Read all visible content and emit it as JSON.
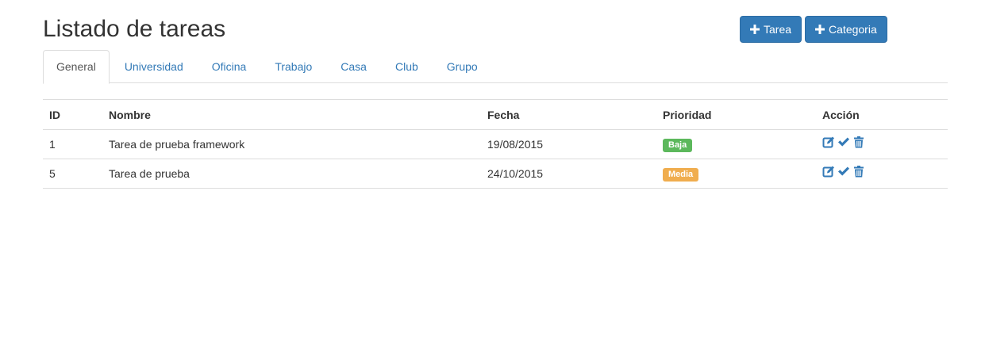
{
  "page": {
    "title": "Listado de tareas"
  },
  "toolbar": {
    "new_task_label": "Tarea",
    "new_category_label": "Categoria",
    "accent": "#337ab7"
  },
  "tabs": [
    {
      "label": "General",
      "active": true
    },
    {
      "label": "Universidad"
    },
    {
      "label": "Oficina"
    },
    {
      "label": "Trabajo"
    },
    {
      "label": "Casa"
    },
    {
      "label": "Club"
    },
    {
      "label": "Grupo"
    }
  ],
  "table": {
    "headers": {
      "id": "ID",
      "nombre": "Nombre",
      "fecha": "Fecha",
      "prioridad": "Prioridad",
      "accion": "Acción"
    },
    "rows": [
      {
        "id": "1",
        "nombre": "Tarea de prueba framework",
        "fecha": "19/08/2015",
        "prioridad": "Baja",
        "prioridad_color": "#5cb85c"
      },
      {
        "id": "5",
        "nombre": "Tarea de prueba",
        "fecha": "24/10/2015",
        "prioridad": "Media",
        "prioridad_color": "#f0ad4e"
      }
    ],
    "action_icons": [
      "edit-icon",
      "check-icon",
      "trash-icon"
    ]
  }
}
